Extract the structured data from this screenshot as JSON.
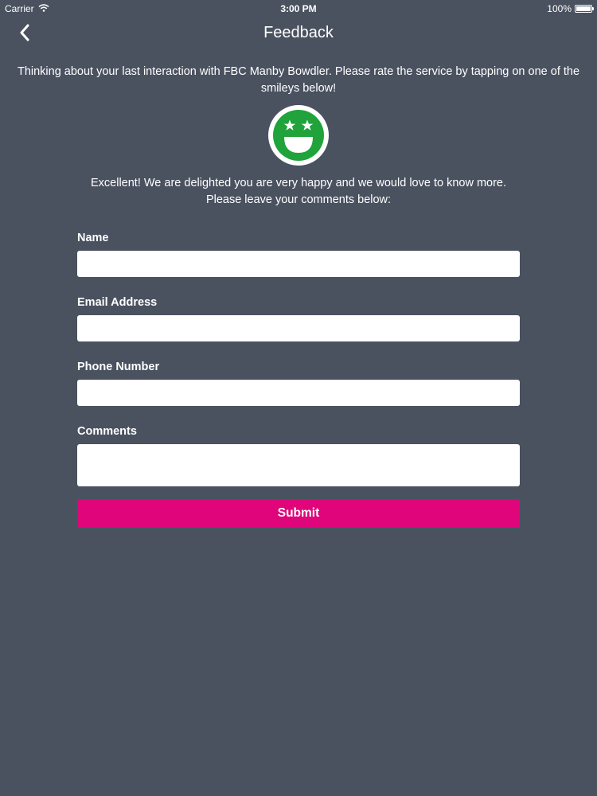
{
  "status_bar": {
    "carrier": "Carrier",
    "time": "3:00 PM",
    "battery": "100%",
    "battery_level": 1.0
  },
  "nav": {
    "title": "Feedback",
    "back_icon": "chevron-left-icon"
  },
  "intro_text": "Thinking about your last interaction with FBC Manby Bowdler. Please rate the service by tapping on one of the smileys below!",
  "rating": {
    "icon": "star-eyes-smiley-icon",
    "color": "#1fa33a"
  },
  "response_line1": "Excellent! We are delighted you are very happy and we would love to know more.",
  "response_line2": "Please leave your comments below:",
  "form": {
    "name_label": "Name",
    "name_value": "",
    "email_label": "Email Address",
    "email_value": "",
    "phone_label": "Phone Number",
    "phone_value": "",
    "comments_label": "Comments",
    "comments_value": "",
    "submit_label": "Submit",
    "submit_color": "#e0057a"
  },
  "colors": {
    "background": "#4a5260",
    "text": "#ffffff"
  }
}
